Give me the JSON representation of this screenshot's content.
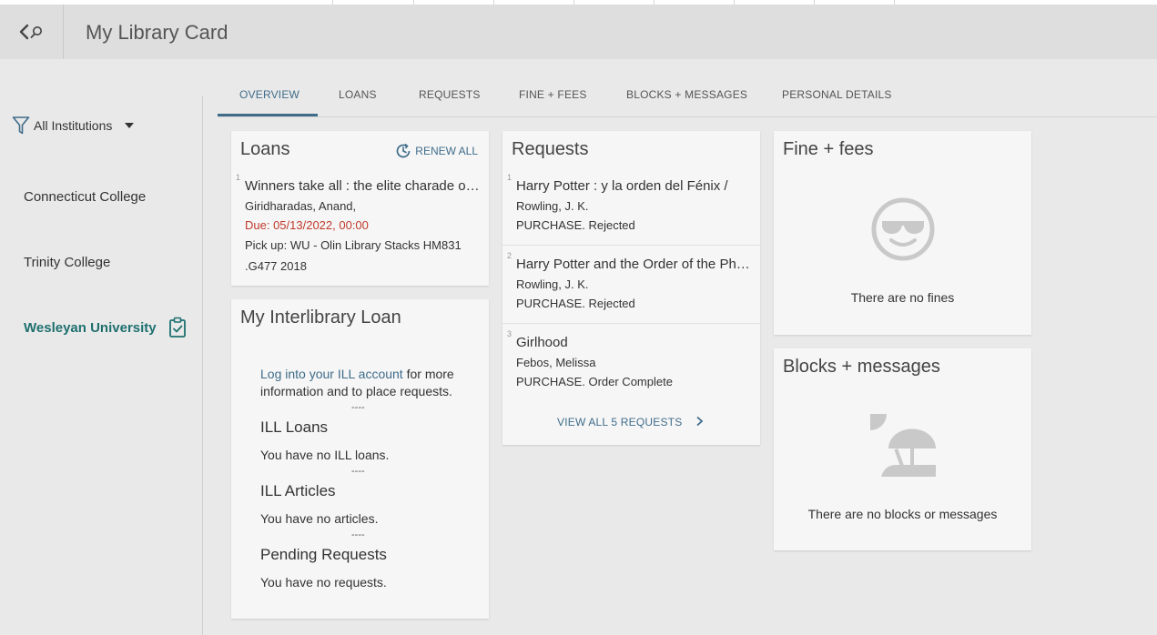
{
  "header": {
    "title": "My Library Card",
    "back_icon": "chevron-left-icon",
    "search_icon": "search-icon"
  },
  "tabs": [
    {
      "label": "OVERVIEW",
      "active": true
    },
    {
      "label": "LOANS"
    },
    {
      "label": "REQUESTS"
    },
    {
      "label": "FINE + FEES"
    },
    {
      "label": "BLOCKS + MESSAGES"
    },
    {
      "label": "PERSONAL DETAILS"
    }
  ],
  "sidebar": {
    "filter_label": "All Institutions",
    "institutions": [
      {
        "label": "Connecticut College"
      },
      {
        "label": "Trinity College"
      },
      {
        "label": "Wesleyan University",
        "active": true
      }
    ]
  },
  "loans": {
    "title": "Loans",
    "renew_label": "RENEW ALL",
    "items": [
      {
        "num": "1",
        "title": "Winners take all : the elite charade of changing the world",
        "author": "Giridharadas, Anand,",
        "due": "Due: 05/13/2022, 00:00",
        "pickup": "Pick up: WU - Olin Library Stacks HM831",
        "pickup2": ".G477 2018"
      }
    ]
  },
  "ill": {
    "title": "My Interlibrary Loan",
    "login_link": "Log into your ILL account",
    "login_rest": " for more",
    "login_line2": "information and to place requests.",
    "separator": "----",
    "loans_heading": "ILL Loans",
    "loans_text": "You have no ILL loans.",
    "articles_heading": "ILL Articles",
    "articles_text": "You have no articles.",
    "pending_heading": "Pending Requests",
    "pending_text": "You have no requests."
  },
  "requests": {
    "title": "Requests",
    "items": [
      {
        "num": "1",
        "title": "Harry Potter : y la orden del Fénix /",
        "author": "Rowling, J. K.",
        "status": "PURCHASE. Rejected"
      },
      {
        "num": "2",
        "title": "Harry Potter and the Order of the Phoenix",
        "author": "Rowling, J. K.",
        "status": "PURCHASE. Rejected"
      },
      {
        "num": "3",
        "title": "Girlhood",
        "author": "Febos, Melissa",
        "status": "PURCHASE. Order Complete"
      }
    ],
    "view_all": "VIEW ALL 5 REQUESTS"
  },
  "fines": {
    "title": "Fine + fees",
    "empty_text": "There are no fines",
    "icon": "sunglasses-smiley-icon"
  },
  "blocks": {
    "title": "Blocks + messages",
    "empty_text": "There are no blocks or messages",
    "icon": "beach-umbrella-icon"
  },
  "colors": {
    "accent": "#3f6c8a",
    "active_institution": "#1f6f6f",
    "due": "#c0392b"
  }
}
